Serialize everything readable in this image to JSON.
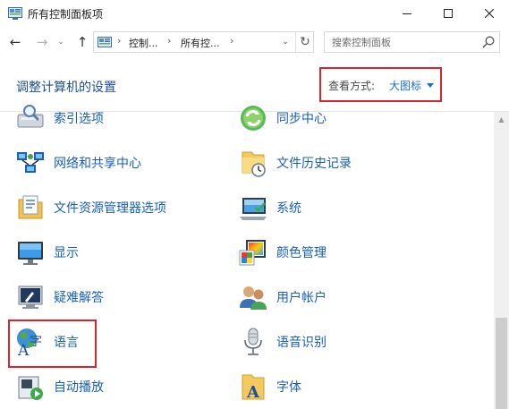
{
  "window": {
    "title": "所有控制面板项",
    "min_label": "—",
    "max_label": "☐",
    "close_label": "✕"
  },
  "nav": {
    "back": "←",
    "forward": "→",
    "recent": "⌄",
    "up": "↑",
    "address": {
      "crumbs": [
        "控制...",
        "所有控..."
      ],
      "separator": "›",
      "dropdown": "⌄",
      "refresh": "↻"
    },
    "search": {
      "placeholder": "搜索控制面板"
    }
  },
  "header": {
    "title": "调整计算机的设置",
    "view_by_label": "查看方式:",
    "view_by_value": "大图标"
  },
  "items": {
    "left": [
      {
        "label": "索引选项",
        "icon": "indexing-options-icon"
      },
      {
        "label": "网络和共享中心",
        "icon": "network-sharing-center-icon"
      },
      {
        "label": "文件资源管理器选项",
        "icon": "file-explorer-options-icon"
      },
      {
        "label": "显示",
        "icon": "display-icon"
      },
      {
        "label": "疑难解答",
        "icon": "troubleshooting-icon"
      },
      {
        "label": "语言",
        "icon": "language-icon"
      },
      {
        "label": "自动播放",
        "icon": "autoplay-icon"
      }
    ],
    "right": [
      {
        "label": "同步中心",
        "icon": "sync-center-icon"
      },
      {
        "label": "文件历史记录",
        "icon": "file-history-icon"
      },
      {
        "label": "系统",
        "icon": "system-icon"
      },
      {
        "label": "颜色管理",
        "icon": "color-management-icon"
      },
      {
        "label": "用户帐户",
        "icon": "user-accounts-icon"
      },
      {
        "label": "语音识别",
        "icon": "speech-recognition-icon"
      },
      {
        "label": "字体",
        "icon": "fonts-icon"
      }
    ]
  },
  "language_icon_glyphs": {
    "a": "A",
    "zi": "字"
  },
  "fonts_icon_glyph": "A",
  "colors": {
    "link": "#1a5fb4",
    "title": "#1c4e91",
    "highlight": "#d8242d",
    "view_value": "#1a6ed0"
  }
}
